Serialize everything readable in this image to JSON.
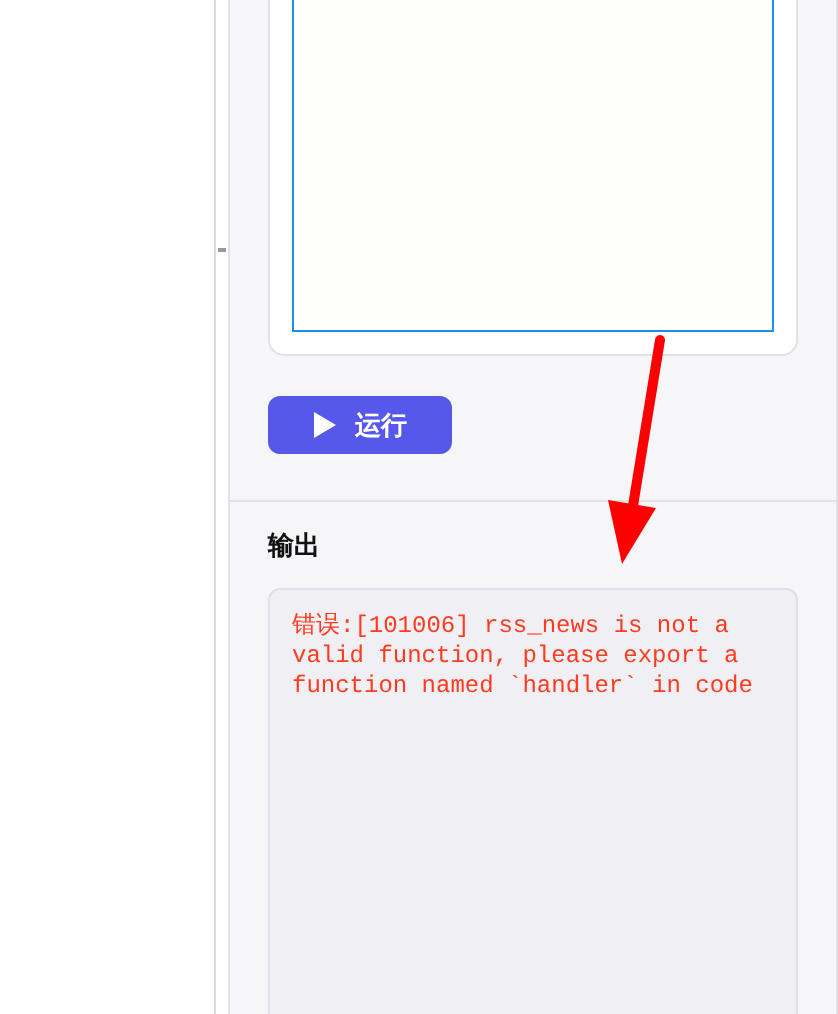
{
  "run_button": {
    "label": "运行"
  },
  "output": {
    "title": "输出",
    "text": "错误:[101006] rss_news is not a valid function, please export a function named `handler` in code",
    "kind": "error"
  }
}
